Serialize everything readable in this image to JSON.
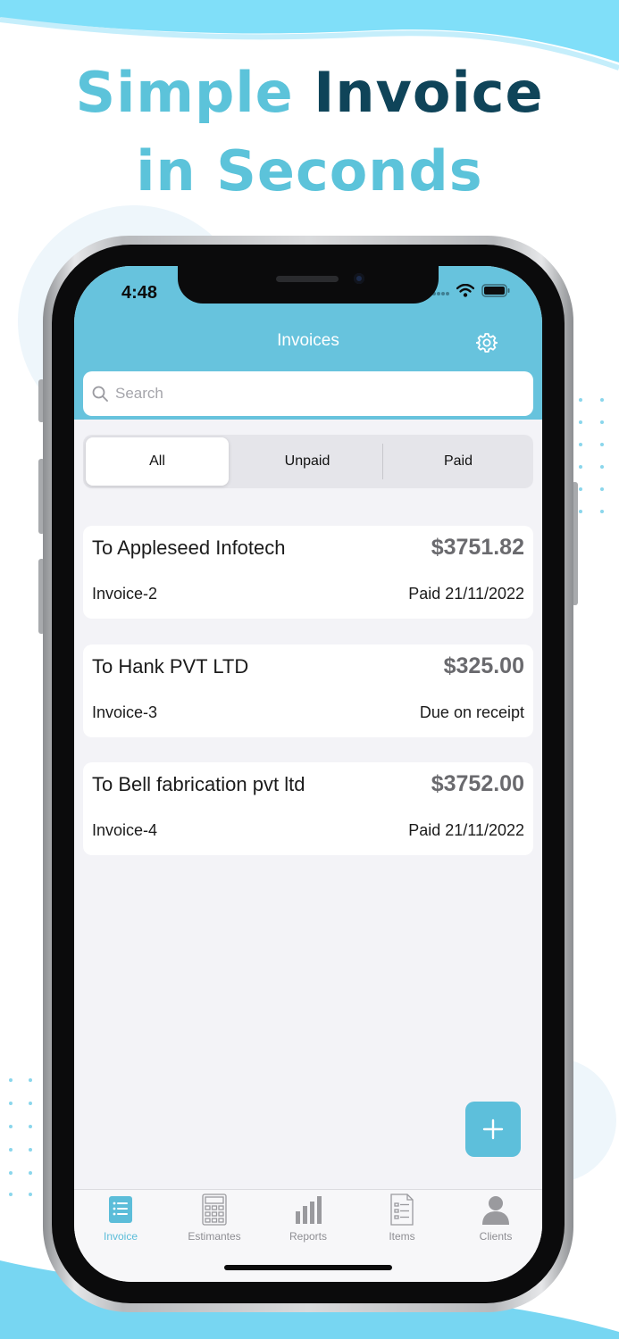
{
  "headline": {
    "line1_light": "Simple",
    "line1_dark": "Invoice",
    "line2": "in Seconds"
  },
  "colors": {
    "accent": "#67c3dd",
    "headline_light": "#5cc3da",
    "headline_dark": "#0f4459",
    "background": "#f3f3f7"
  },
  "status_bar": {
    "time": "4:48",
    "icons": [
      "wifi-icon",
      "battery-icon"
    ]
  },
  "nav": {
    "title": "Invoices",
    "settings_icon": "gear-icon"
  },
  "search": {
    "placeholder": "Search",
    "icon": "search-icon"
  },
  "filter": {
    "selected": "All",
    "options": [
      "All",
      "Unpaid",
      "Paid"
    ]
  },
  "invoices": [
    {
      "client": "To Appleseed Infotech",
      "amount": "$3751.82",
      "number": "Invoice-2",
      "status": "Paid 21/11/2022"
    },
    {
      "client": "To Hank PVT LTD",
      "amount": "$325.00",
      "number": "Invoice-3",
      "status": "Due on receipt"
    },
    {
      "client": "To Bell fabrication pvt ltd",
      "amount": "$3752.00",
      "number": "Invoice-4",
      "status": "Paid 21/11/2022"
    }
  ],
  "fab": {
    "icon": "plus-icon"
  },
  "tabs": [
    {
      "label": "Invoice",
      "icon": "invoice-list-icon",
      "active": true
    },
    {
      "label": "Estimantes",
      "icon": "calculator-icon",
      "active": false
    },
    {
      "label": "Reports",
      "icon": "bar-chart-icon",
      "active": false
    },
    {
      "label": "Items",
      "icon": "document-icon",
      "active": false
    },
    {
      "label": "Clients",
      "icon": "person-icon",
      "active": false
    }
  ]
}
